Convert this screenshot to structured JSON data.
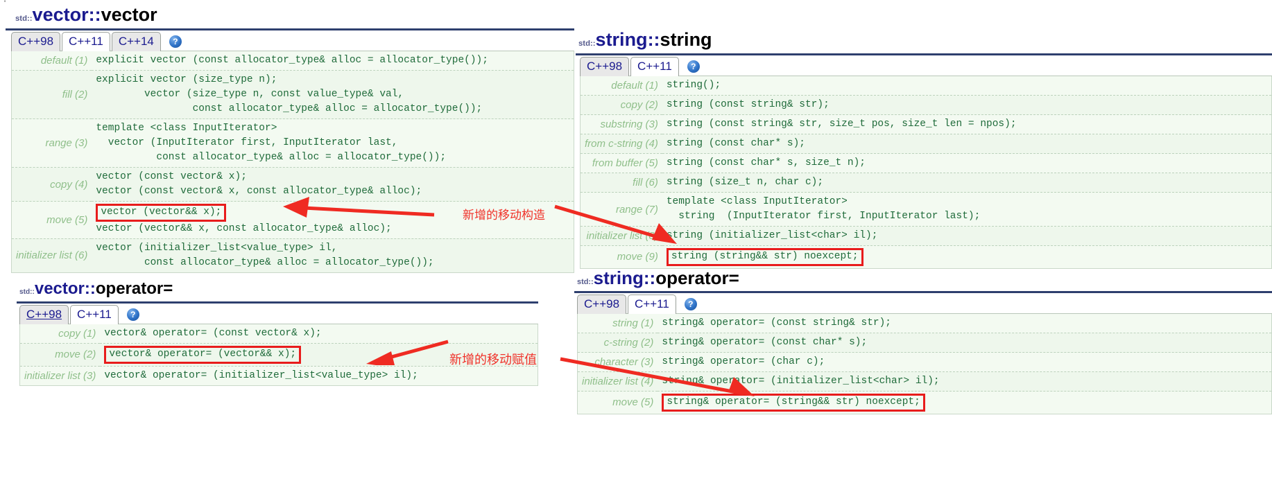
{
  "stray_mark": "'",
  "panels": {
    "vector_ctor": {
      "title_ns": "std::",
      "title_class": "vector",
      "title_sep": "::",
      "title_member": "vector",
      "tabs": [
        {
          "label": "C++98",
          "active": false
        },
        {
          "label": "C++11",
          "active": true
        },
        {
          "label": "C++14",
          "active": false
        }
      ],
      "help_label": "?",
      "rows": [
        {
          "label": "default (1)",
          "code": "explicit vector (const allocator_type& alloc = allocator_type());"
        },
        {
          "label": "fill (2)",
          "code": "explicit vector (size_type n);\n        vector (size_type n, const value_type& val,\n                const allocator_type& alloc = allocator_type());"
        },
        {
          "label": "range (3)",
          "code": "template <class InputIterator>\n  vector (InputIterator first, InputIterator last,\n          const allocator_type& alloc = allocator_type());"
        },
        {
          "label": "copy (4)",
          "code": "vector (const vector& x);\nvector (const vector& x, const allocator_type& alloc);"
        },
        {
          "label": "move (5)",
          "code_boxed": "vector (vector&& x);",
          "code_rest": "vector (vector&& x, const allocator_type& alloc);"
        },
        {
          "label": "initializer list (6)",
          "code": "vector (initializer_list<value_type> il,\n        const allocator_type& alloc = allocator_type());"
        }
      ]
    },
    "string_ctor": {
      "title_ns": "std::",
      "title_class": "string",
      "title_sep": "::",
      "title_member": "string",
      "tabs": [
        {
          "label": "C++98",
          "active": false
        },
        {
          "label": "C++11",
          "active": true
        }
      ],
      "help_label": "?",
      "rows": [
        {
          "label": "default (1)",
          "code": "string();"
        },
        {
          "label": "copy (2)",
          "code": "string (const string& str);"
        },
        {
          "label": "substring (3)",
          "code": "string (const string& str, size_t pos, size_t len = npos);"
        },
        {
          "label": "from c-string (4)",
          "code": "string (const char* s);"
        },
        {
          "label": "from buffer (5)",
          "code": "string (const char* s, size_t n);"
        },
        {
          "label": "fill (6)",
          "code": "string (size_t n, char c);"
        },
        {
          "label": "range (7)",
          "code": "template <class InputIterator>\n  string  (InputIterator first, InputIterator last);"
        },
        {
          "label": "initializer list (8)",
          "code": "string (initializer_list<char> il);"
        },
        {
          "label": "move (9)",
          "code_boxed": "string (string&& str) noexcept;"
        }
      ]
    },
    "vector_assign": {
      "title_ns": "std::",
      "title_class": "vector",
      "title_sep": "::",
      "title_member": "operator=",
      "tabs": [
        {
          "label": "C++98",
          "active": false,
          "hover": true
        },
        {
          "label": "C++11",
          "active": true
        }
      ],
      "help_label": "?",
      "rows": [
        {
          "label": "copy (1)",
          "code": "vector& operator= (const vector& x);"
        },
        {
          "label": "move (2)",
          "code_boxed": "vector& operator= (vector&& x);"
        },
        {
          "label": "initializer list (3)",
          "code": "vector& operator= (initializer_list<value_type> il);"
        }
      ]
    },
    "string_assign": {
      "title_ns": "std::",
      "title_class": "string",
      "title_sep": "::",
      "title_member": "operator=",
      "tabs": [
        {
          "label": "C++98",
          "active": false
        },
        {
          "label": "C++11",
          "active": true
        }
      ],
      "help_label": "?",
      "rows": [
        {
          "label": "string (1)",
          "code": "string& operator= (const string& str);"
        },
        {
          "label": "c-string (2)",
          "code": "string& operator= (const char* s);"
        },
        {
          "label": "character (3)",
          "code": "string& operator= (char c);"
        },
        {
          "label": "initializer list (4)",
          "code": "string& operator= (initializer_list<char> il);"
        },
        {
          "label": "move (5)",
          "code_boxed": "string& operator= (string&& str) noexcept;"
        }
      ]
    }
  },
  "annotations": {
    "move_ctor_note": "新增的移动构造",
    "move_assign_note": "新增的移动赋值"
  },
  "colors": {
    "accent_red": "#f0322a",
    "title_blue": "#1b1b8f",
    "code_green": "#1f6b3a",
    "label_green": "#8fbf8a",
    "table_bg": "#f3faf1",
    "rule_navy": "#2e3f6e"
  }
}
